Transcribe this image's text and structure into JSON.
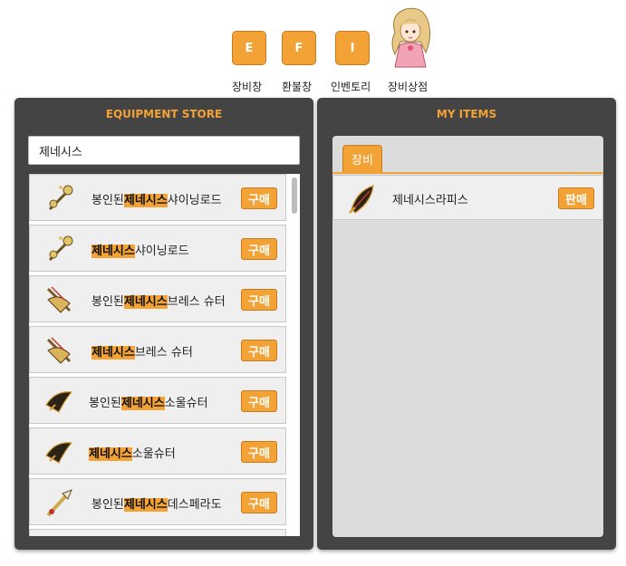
{
  "toolbar": {
    "buttons": [
      {
        "key": "E",
        "label": "장비창"
      },
      {
        "key": "F",
        "label": "환불창"
      },
      {
        "key": "I",
        "label": "인벤토리"
      }
    ],
    "npc_label": "장비상점"
  },
  "store": {
    "title": "EQUIPMENT STORE",
    "search_value": "제네시스",
    "buy_label": "구매",
    "items": [
      {
        "prefix": "봉인된",
        "match": "제네시스",
        "suffix": "샤이닝로드",
        "icon": "shining-rod-icon"
      },
      {
        "prefix": "",
        "match": "제네시스",
        "suffix": "샤이닝로드",
        "icon": "shining-rod-icon"
      },
      {
        "prefix": "봉인된",
        "match": "제네시스",
        "suffix": "브레스 슈터",
        "icon": "breath-shooter-icon"
      },
      {
        "prefix": "",
        "match": "제네시스",
        "suffix": "브레스 슈터",
        "icon": "breath-shooter-icon"
      },
      {
        "prefix": "봉인된",
        "match": "제네시스",
        "suffix": "소울슈터",
        "icon": "soul-shooter-icon"
      },
      {
        "prefix": "",
        "match": "제네시스",
        "suffix": "소울슈터",
        "icon": "soul-shooter-icon"
      },
      {
        "prefix": "봉인된",
        "match": "제네시스",
        "suffix": "데스페라도",
        "icon": "desperado-icon"
      }
    ]
  },
  "my_items": {
    "title": "MY ITEMS",
    "tab_label": "장비",
    "sell_label": "판매",
    "items": [
      {
        "name": "제네시스라피스",
        "icon": "lapis-icon"
      }
    ]
  },
  "colors": {
    "accent": "#f3a235",
    "panel": "#444444"
  }
}
